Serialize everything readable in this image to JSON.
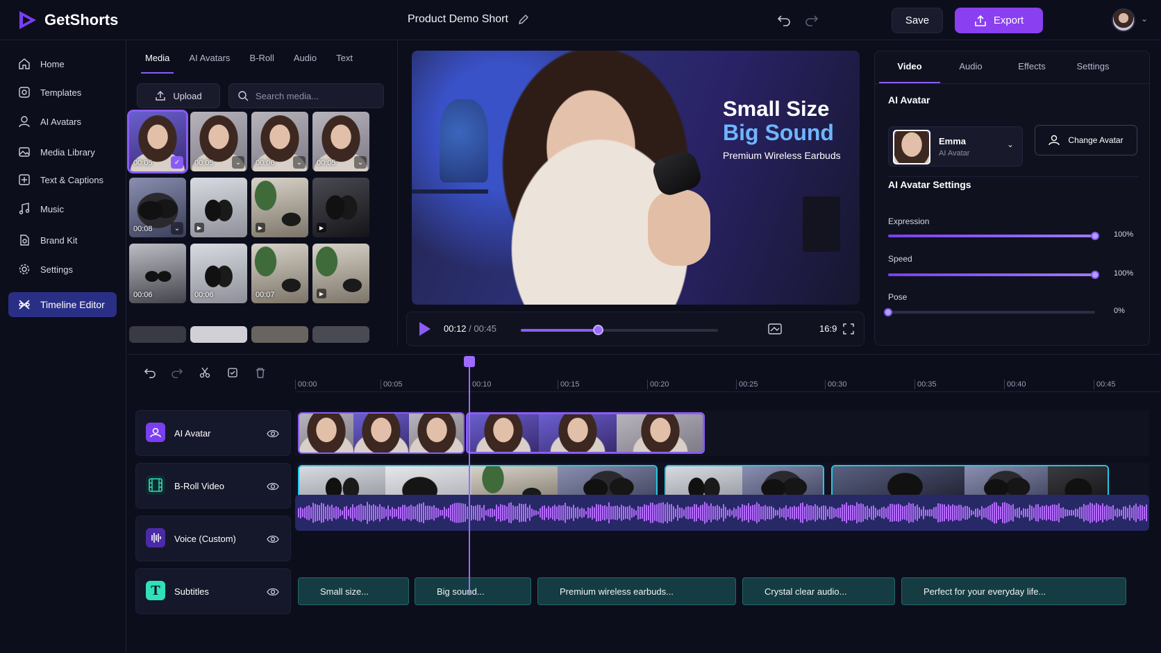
{
  "app": {
    "name": "GetShorts",
    "project_title": "Product Demo Short"
  },
  "header": {
    "save_label": "Save",
    "export_label": "Export"
  },
  "sidebar": {
    "items": [
      {
        "label": "Home",
        "icon": "home-icon"
      },
      {
        "label": "Templates",
        "icon": "templates-icon"
      },
      {
        "label": "AI Avatars",
        "icon": "user-icon"
      },
      {
        "label": "Media Library",
        "icon": "image-icon"
      },
      {
        "label": "Text & Captions",
        "icon": "text-plus-icon"
      },
      {
        "label": "Music",
        "icon": "music-icon"
      },
      {
        "label": "Brand Kit",
        "icon": "brand-icon"
      },
      {
        "label": "Settings",
        "icon": "gear-icon"
      },
      {
        "label": "Timeline Editor",
        "icon": "timeline-icon",
        "active": true
      }
    ]
  },
  "media": {
    "tabs": [
      "Media",
      "AI Avatars",
      "B-Roll",
      "Audio",
      "Text"
    ],
    "active_tab": "Media",
    "upload_label": "Upload",
    "search_placeholder": "Search media...",
    "thumbs": [
      {
        "duration": "00:05",
        "kind": "avatar",
        "selected": true
      },
      {
        "duration": "00:05",
        "kind": "avatar"
      },
      {
        "duration": "00:06",
        "kind": "avatar"
      },
      {
        "duration": "00:05",
        "kind": "avatar"
      },
      {
        "duration": "00:08",
        "kind": "broll"
      },
      {
        "duration": "",
        "kind": "broll"
      },
      {
        "duration": "",
        "kind": "broll"
      },
      {
        "duration": "",
        "kind": "broll"
      },
      {
        "duration": "00:06",
        "kind": "broll"
      },
      {
        "duration": "00:06",
        "kind": "broll"
      },
      {
        "duration": "00:07",
        "kind": "broll"
      },
      {
        "duration": "",
        "kind": "broll"
      }
    ]
  },
  "preview": {
    "overlay_line1": "Small Size",
    "overlay_line2": "Big Sound",
    "overlay_line3": "Premium Wireless Earbuds",
    "current_time": "00:12",
    "total_time": "/ 00:45",
    "progress": 0.39,
    "aspect_ratio": "16:9"
  },
  "inspector": {
    "tabs": [
      "Video",
      "Audio",
      "Effects",
      "Settings"
    ],
    "active_tab": "Video",
    "avatar_section_title": "AI Avatar",
    "avatar_name": "Emma",
    "avatar_subtitle": "AI Avatar",
    "change_avatar_label": "Change Avatar",
    "settings_title": "AI Avatar Settings",
    "sliders": [
      {
        "label": "Expression",
        "value": 1.0,
        "value_text": "100%"
      },
      {
        "label": "Speed",
        "value": 1.0,
        "value_text": "100%"
      },
      {
        "label": "Pose",
        "value": 0.0,
        "value_text": "0%"
      }
    ]
  },
  "timeline": {
    "ruler": [
      "00:00",
      "00:05",
      "00:10",
      "00:15",
      "00:20",
      "00:25",
      "00:30",
      "00:35",
      "00:40",
      "00:45"
    ],
    "playhead_time": "00:12",
    "tracks": [
      {
        "name": "AI Avatar",
        "icon": "avatar-track-icon"
      },
      {
        "name": "B-Roll Video",
        "icon": "film-icon"
      },
      {
        "name": "Voice (Custom)",
        "icon": "waveform-icon"
      },
      {
        "name": "Subtitles",
        "icon": "text-t-icon"
      }
    ],
    "subtitles": [
      "Small size...",
      "Big sound...",
      "Premium wireless earbuds...",
      "Crystal clear audio...",
      "Perfect for your everyday life..."
    ]
  },
  "colors": {
    "accent": "#8a5cf6",
    "broll": "#22c8e6",
    "subtitle": "#143c42",
    "active_nav": "#2a2f86"
  }
}
